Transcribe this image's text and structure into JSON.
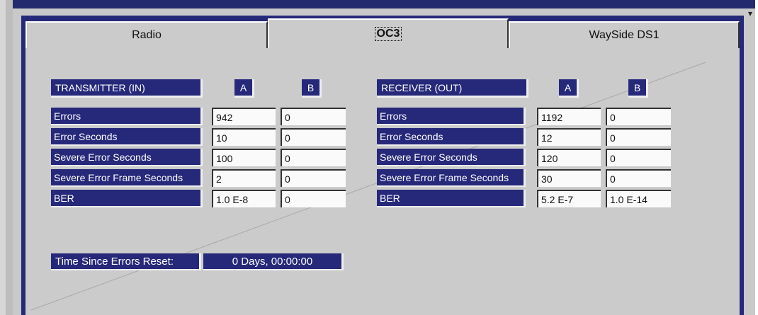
{
  "tabs": [
    {
      "label": "Radio"
    },
    {
      "label": "OC3"
    },
    {
      "label": "WaySide DS1"
    }
  ],
  "transmitter": {
    "header": "TRANSMITTER (IN)",
    "col_a": "A",
    "col_b": "B",
    "rows": [
      {
        "label": "Errors",
        "a": "942",
        "b": "0"
      },
      {
        "label": "Error Seconds",
        "a": "10",
        "b": "0"
      },
      {
        "label": "Severe Error Seconds",
        "a": "100",
        "b": "0"
      },
      {
        "label": "Severe Error Frame Seconds",
        "a": "2",
        "b": "0"
      },
      {
        "label": "BER",
        "a": "1.0 E-8",
        "b": "0"
      }
    ]
  },
  "receiver": {
    "header": "RECEIVER (OUT)",
    "col_a": "A",
    "col_b": "B",
    "rows": [
      {
        "label": "Errors",
        "a": "1192",
        "b": "0"
      },
      {
        "label": "Error Seconds",
        "a": "12",
        "b": "0"
      },
      {
        "label": "Severe Error Seconds",
        "a": "120",
        "b": "0"
      },
      {
        "label": "Severe Error Frame Seconds",
        "a": "30",
        "b": "0"
      },
      {
        "label": "BER",
        "a": "5.2 E-7",
        "b": "1.0 E-14"
      }
    ]
  },
  "reset": {
    "label": "Time Since Errors Reset:",
    "value": "0 Days, 00:00:00"
  },
  "colors": {
    "navy": "#26287a",
    "panel": "#cbcbcb",
    "cell": "#fafafa"
  }
}
